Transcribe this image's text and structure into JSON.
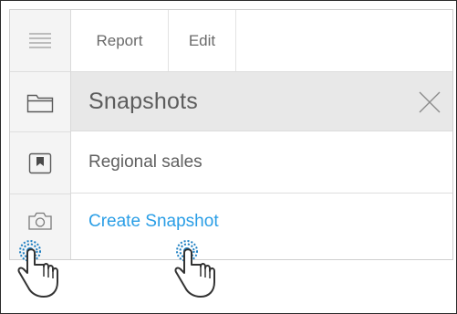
{
  "toolbar": {
    "tabs": [
      {
        "label": "Report"
      },
      {
        "label": "Edit"
      }
    ]
  },
  "panel": {
    "title": "Snapshots",
    "items": [
      {
        "label": "Regional sales",
        "icon": "bookmark-icon"
      },
      {
        "label": "Create Snapshot",
        "icon": "camera-icon",
        "color": "#2a9ee6"
      }
    ]
  },
  "sidebar": {
    "icons": [
      "menu-icon",
      "folder-icon",
      "bookmark-icon",
      "camera-icon"
    ]
  },
  "colors": {
    "accent": "#2a9ee6",
    "header_bg": "#e8e8e8",
    "rail_bg": "#f4f4f4",
    "tap_highlight": "#1d7fc2"
  }
}
